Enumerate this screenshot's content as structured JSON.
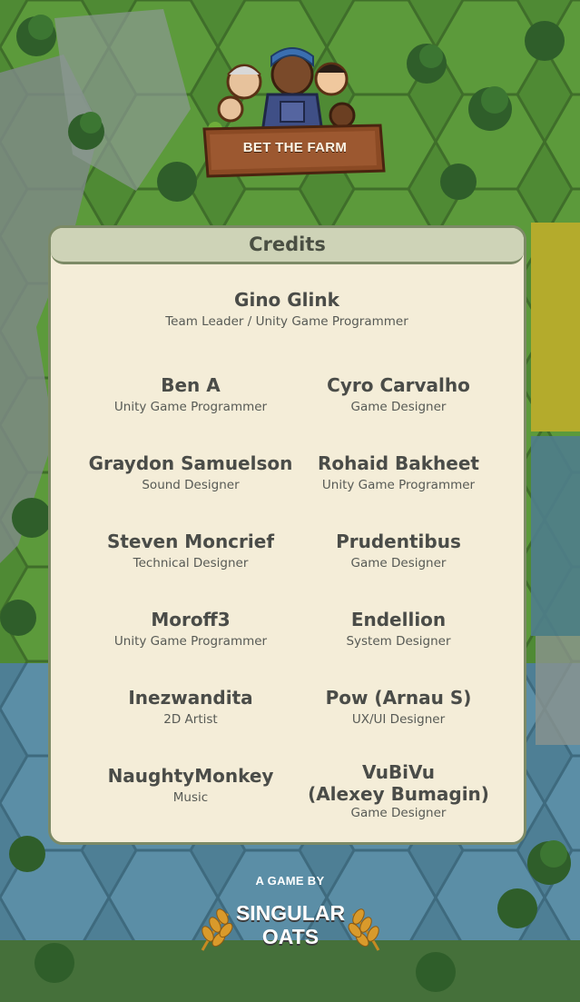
{
  "game": {
    "logo_text": "BET THE FARM"
  },
  "credits": {
    "title": "Credits",
    "lead": {
      "name": "Gino Glink",
      "role": "Team Leader / Unity Game Programmer"
    },
    "people": [
      {
        "name": "Ben A",
        "role": "Unity Game Programmer"
      },
      {
        "name": "Cyro Carvalho",
        "role": "Game Designer"
      },
      {
        "name": "Graydon Samuelson",
        "role": "Sound Designer"
      },
      {
        "name": "Rohaid Bakheet",
        "role": "Unity Game Programmer"
      },
      {
        "name": "Steven Moncrief",
        "role": "Technical Designer"
      },
      {
        "name": "Prudentibus",
        "role": "Game Designer"
      },
      {
        "name": "Moroff3",
        "role": "Unity Game Programmer"
      },
      {
        "name": "Endellion",
        "role": "System Designer"
      },
      {
        "name": "Inezwandita",
        "role": "2D Artist"
      },
      {
        "name": "Pow (Arnau S)",
        "role": "UX/UI Designer"
      },
      {
        "name": "NaughtyMonkey",
        "role": "Music"
      },
      {
        "name": "VuBiVu",
        "name_line2": "(Alexey Bumagin)",
        "role": "Game Designer"
      }
    ]
  },
  "footer": {
    "label": "A GAME BY",
    "studio_line1": "SINGULAR",
    "studio_line2": "OATS"
  },
  "colors": {
    "panel_bg": "#f4edd8",
    "panel_border": "#7c8a66",
    "header_bg": "#ced3b7",
    "text": "#4a4c48",
    "wheat": "#d99a2b"
  },
  "icons": [
    "farm-logo-icon",
    "wheat-laurel-icon"
  ]
}
